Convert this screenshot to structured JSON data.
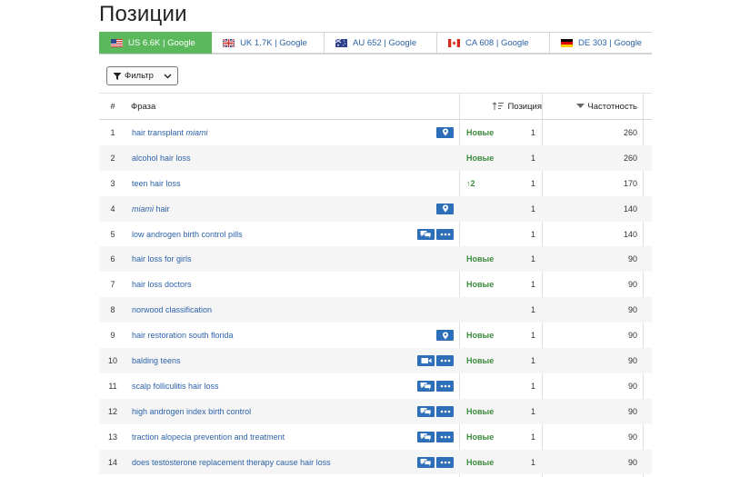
{
  "page": {
    "title": "Позиции"
  },
  "tabs": [
    {
      "label": "US 6.6K | Google",
      "flag": "us",
      "active": true
    },
    {
      "label": "UK 1.7K | Google",
      "flag": "uk",
      "active": false
    },
    {
      "label": "AU 652 | Google",
      "flag": "au",
      "active": false
    },
    {
      "label": "CA 608 | Google",
      "flag": "ca",
      "active": false
    },
    {
      "label": "DE 303 | Google",
      "flag": "de",
      "active": false
    }
  ],
  "filter": {
    "label": "Фильтр"
  },
  "table": {
    "headers": {
      "num": "#",
      "phrase": "Фраза",
      "position": "Позиция",
      "frequency": "Частотность"
    },
    "rows": [
      {
        "num": "1",
        "phrase": "hair transplant ",
        "phrase_italic": "miami",
        "icons": [
          "location"
        ],
        "status": "Новые",
        "position": "1",
        "frequency": "260"
      },
      {
        "num": "2",
        "phrase": "alcohol hair loss",
        "phrase_italic": "",
        "icons": [],
        "status": "Новые",
        "position": "1",
        "frequency": "260"
      },
      {
        "num": "3",
        "phrase": "teen hair loss",
        "phrase_italic": "",
        "icons": [],
        "status": "↑2",
        "position": "1",
        "frequency": "170"
      },
      {
        "num": "4",
        "phrase": "",
        "phrase_italic": "miami",
        "phrase_after": " hair",
        "icons": [
          "location"
        ],
        "status": "",
        "position": "1",
        "frequency": "140"
      },
      {
        "num": "5",
        "phrase": "low androgen birth control pills",
        "phrase_italic": "",
        "icons": [
          "comments",
          "more"
        ],
        "status": "",
        "position": "1",
        "frequency": "140"
      },
      {
        "num": "6",
        "phrase": "hair loss for girls",
        "phrase_italic": "",
        "icons": [],
        "status": "Новые",
        "position": "1",
        "frequency": "90"
      },
      {
        "num": "7",
        "phrase": "hair loss doctors",
        "phrase_italic": "",
        "icons": [],
        "status": "Новые",
        "position": "1",
        "frequency": "90"
      },
      {
        "num": "8",
        "phrase": "norwood classification",
        "phrase_italic": "",
        "icons": [],
        "status": "",
        "position": "1",
        "frequency": "90"
      },
      {
        "num": "9",
        "phrase": "hair restoration south florida",
        "phrase_italic": "",
        "icons": [
          "location"
        ],
        "status": "Новые",
        "position": "1",
        "frequency": "90"
      },
      {
        "num": "10",
        "phrase": "balding teens",
        "phrase_italic": "",
        "icons": [
          "video",
          "more"
        ],
        "status": "Новые",
        "position": "1",
        "frequency": "90"
      },
      {
        "num": "11",
        "phrase": "scalp folliculitis hair loss",
        "phrase_italic": "",
        "icons": [
          "comments",
          "more"
        ],
        "status": "",
        "position": "1",
        "frequency": "90"
      },
      {
        "num": "12",
        "phrase": "high androgen index birth control",
        "phrase_italic": "",
        "icons": [
          "comments",
          "more"
        ],
        "status": "Новые",
        "position": "1",
        "frequency": "90"
      },
      {
        "num": "13",
        "phrase": "traction alopecia prevention and treatment",
        "phrase_italic": "",
        "icons": [
          "comments",
          "more"
        ],
        "status": "Новые",
        "position": "1",
        "frequency": "90"
      },
      {
        "num": "14",
        "phrase": "does testosterone replacement therapy cause hair loss",
        "phrase_italic": "",
        "icons": [
          "comments",
          "more"
        ],
        "status": "Новые",
        "position": "1",
        "frequency": "90"
      }
    ]
  }
}
